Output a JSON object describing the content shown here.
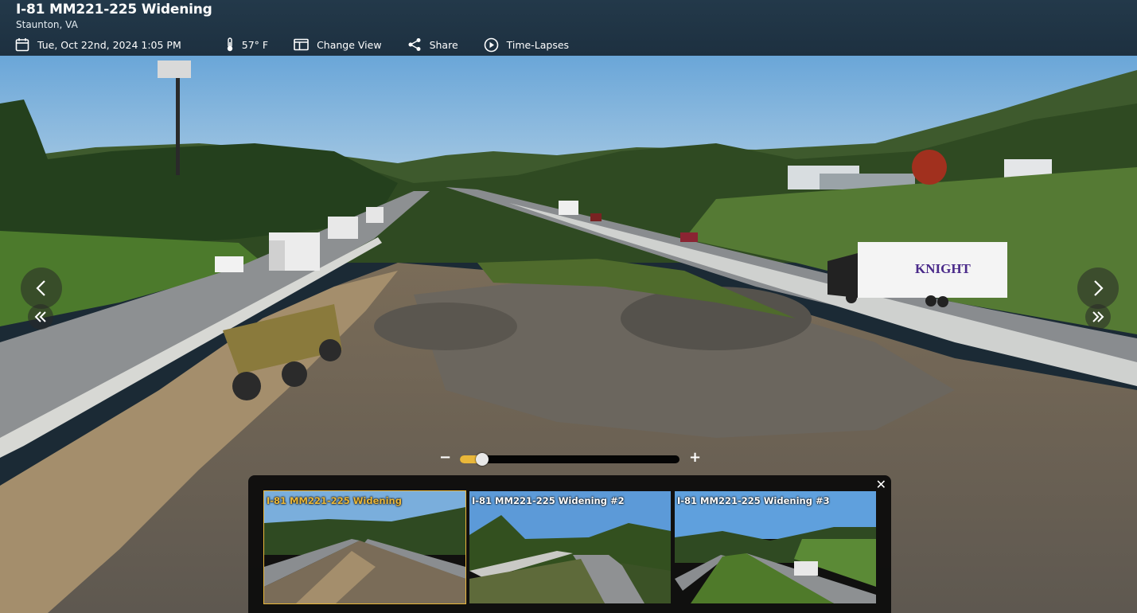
{
  "header": {
    "title": "I-81 MM221-225 Widening",
    "location": "Staunton, VA",
    "datetime": "Tue, Oct 22nd, 2024 1:05 PM",
    "temperature": "57° F",
    "change_view_label": "Change View",
    "share_label": "Share",
    "timelapses_label": "Time-Lapses"
  },
  "icons": {
    "calendar": "calendar-icon",
    "thermometer": "thermometer-icon",
    "change_view": "layout-icon",
    "share": "share-icon",
    "timelapses": "play-circle-icon",
    "prev": "chevron-left-icon",
    "next": "chevron-right-icon",
    "first": "double-chevron-left-icon",
    "last": "double-chevron-right-icon",
    "close": "close-icon"
  },
  "zoom": {
    "minus_label": "−",
    "plus_label": "+",
    "level": 0.1
  },
  "camera_view": {
    "truck_text": "KNIGHT"
  },
  "thumbnails": [
    {
      "label": "I-81 MM221-225 Widening",
      "active": true
    },
    {
      "label": "I-81 MM221-225 Widening #2",
      "active": false
    },
    {
      "label": "I-81 MM221-225 Widening #3",
      "active": false
    }
  ],
  "tray": {
    "close_label": "✕"
  },
  "colors": {
    "accent": "#e9b73a",
    "header_bg": "#22374a"
  }
}
